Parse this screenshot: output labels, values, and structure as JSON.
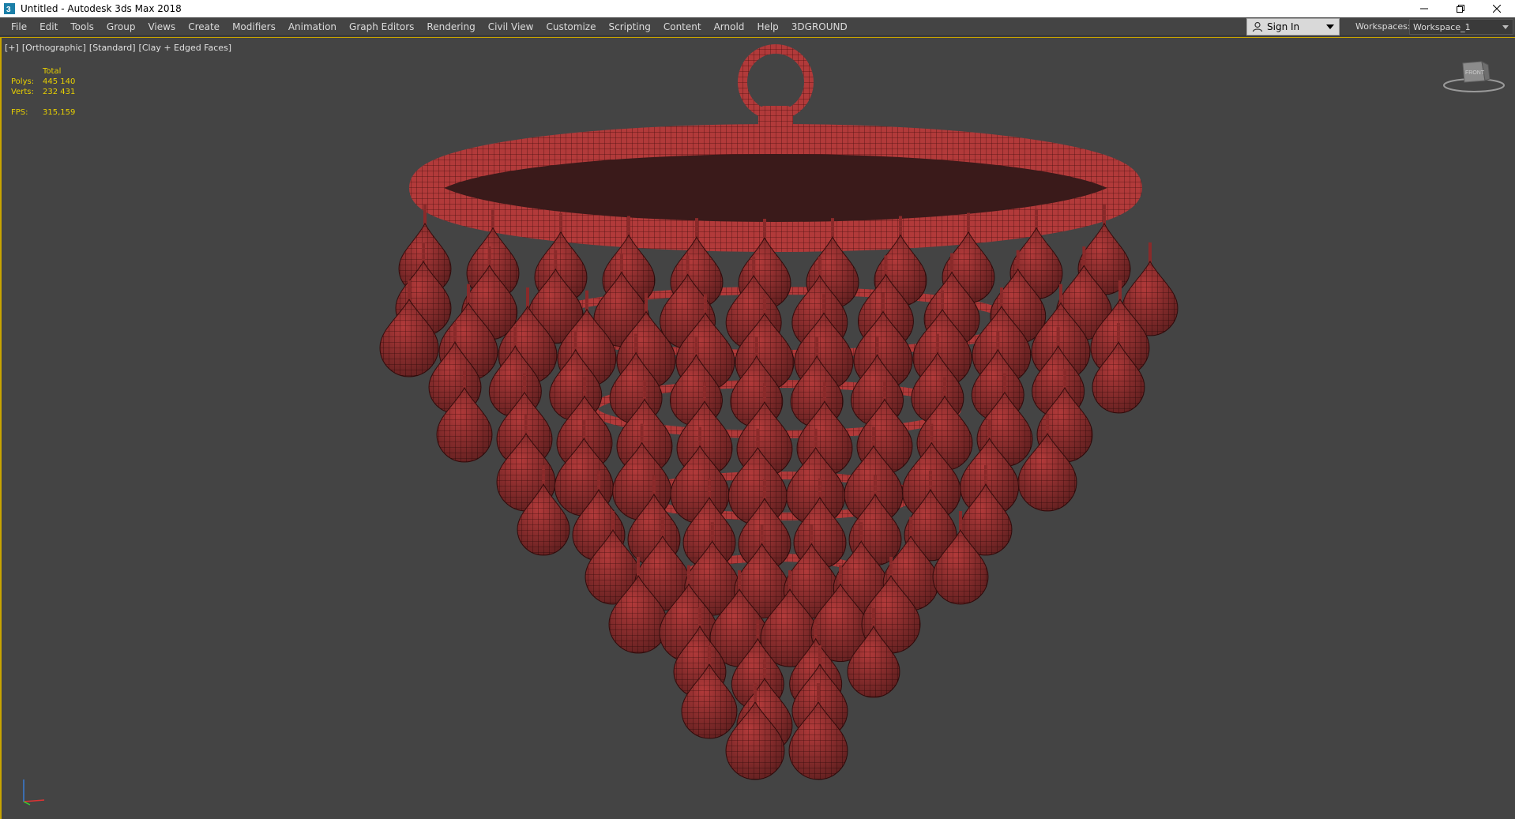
{
  "window": {
    "title": "Untitled - Autodesk 3ds Max 2018",
    "controls": [
      "minimize-icon",
      "restore-icon",
      "close-icon"
    ]
  },
  "menubar": {
    "items": [
      "File",
      "Edit",
      "Tools",
      "Group",
      "Views",
      "Create",
      "Modifiers",
      "Animation",
      "Graph Editors",
      "Rendering",
      "Civil View",
      "Customize",
      "Scripting",
      "Content",
      "Arnold",
      "Help",
      "3DGROUND"
    ]
  },
  "signin": {
    "label": "Sign In",
    "icon": "user-icon"
  },
  "workspaces": {
    "label": "Workspaces:",
    "value": "Workspace_1"
  },
  "viewport": {
    "label_plus": "[+]",
    "label_view": "[Orthographic]",
    "label_shading": "[Standard]",
    "label_mode": "[Clay + Edged Faces]",
    "stats": {
      "header": "Total",
      "polys_label": "Polys:",
      "polys_value": "445 140",
      "verts_label": "Verts:",
      "verts_value": "232 431",
      "fps_label": "FPS:",
      "fps_value": "315,159"
    },
    "viewcube_label": "FRONT",
    "colors": {
      "background": "#444444",
      "border": "#c8a400",
      "stats": "#e8d000",
      "model": "#b23a3a",
      "wire": "#4a1010"
    }
  }
}
